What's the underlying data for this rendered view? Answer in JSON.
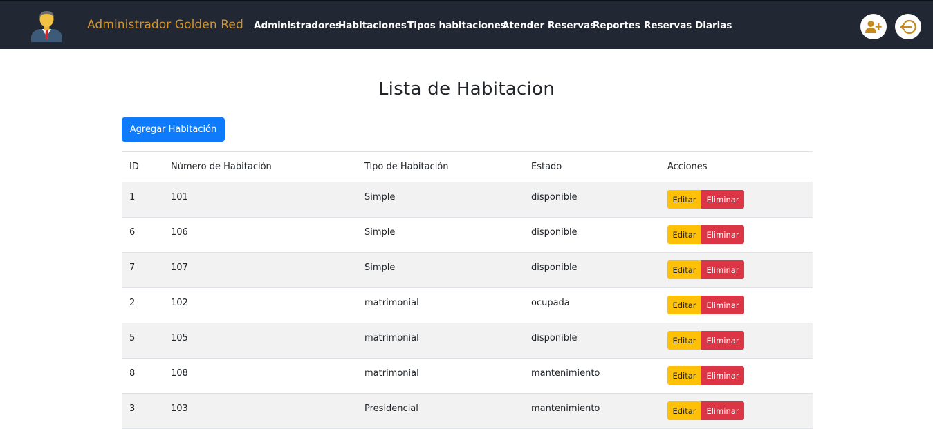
{
  "navbar": {
    "brand": "Administrador Golden Red",
    "links": [
      "Administradores",
      "Habitaciones",
      "Tipos habitaciones",
      "Atender Reservas",
      "Reportes",
      "Reservas Diarias"
    ],
    "icons": [
      "add-user-icon",
      "logout-icon"
    ]
  },
  "main": {
    "title": "Lista de Habitacion",
    "add_button": "Agregar Habitación"
  },
  "table": {
    "headers": [
      "ID",
      "Número de Habitación",
      "Tipo de Habitación",
      "Estado",
      "Acciones"
    ],
    "edit_label": "Editar",
    "delete_label": "Eliminar",
    "rows": [
      {
        "id": "1",
        "numero": "101",
        "tipo": "Simple",
        "estado": "disponible"
      },
      {
        "id": "6",
        "numero": "106",
        "tipo": "Simple",
        "estado": "disponible"
      },
      {
        "id": "7",
        "numero": "107",
        "tipo": "Simple",
        "estado": "disponible"
      },
      {
        "id": "2",
        "numero": "102",
        "tipo": "matrimonial",
        "estado": "ocupada"
      },
      {
        "id": "5",
        "numero": "105",
        "tipo": "matrimonial",
        "estado": "disponible"
      },
      {
        "id": "8",
        "numero": "108",
        "tipo": "matrimonial",
        "estado": "mantenimiento"
      },
      {
        "id": "3",
        "numero": "103",
        "tipo": "Presidencial",
        "estado": "mantenimiento"
      }
    ]
  },
  "colors": {
    "navbar_bg": "#212733",
    "brand": "#d4952a",
    "primary": "#0d7bfa",
    "warning": "#ffc107",
    "danger": "#dc3545"
  }
}
